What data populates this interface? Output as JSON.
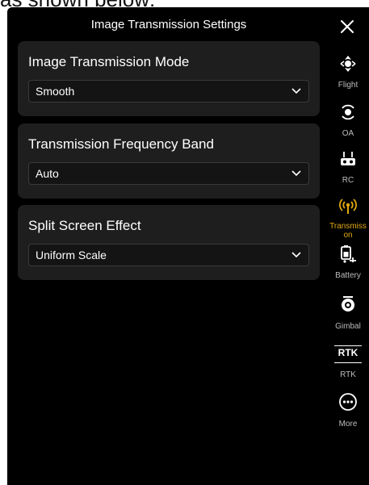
{
  "above_text": "as shown below:",
  "panel": {
    "title": "Image Transmission Settings"
  },
  "settings": [
    {
      "label": "Image Transmission Mode",
      "value": "Smooth"
    },
    {
      "label": "Transmission Frequency Band",
      "value": "Auto"
    },
    {
      "label": "Split Screen Effect",
      "value": "Uniform Scale"
    }
  ],
  "sidebar": {
    "items": [
      {
        "label": "Flight",
        "icon": "drone-icon"
      },
      {
        "label": "OA",
        "icon": "obstacle-avoidance-icon"
      },
      {
        "label": "RC",
        "icon": "remote-controller-icon"
      },
      {
        "label_line1": "Transmiss",
        "label_line2": "on",
        "icon": "signal-antenna-icon",
        "active": true
      },
      {
        "label": "Battery",
        "icon": "battery-icon"
      },
      {
        "label": "Gimbal",
        "icon": "gimbal-icon"
      },
      {
        "label": "RTK",
        "icon_text": "RTK",
        "icon": "rtk-icon"
      },
      {
        "label": "More",
        "icon": "more-icon"
      }
    ]
  },
  "colors": {
    "accent": "#e0a90f",
    "panel_bg": "#000000",
    "card_bg": "#1e1e1e"
  }
}
